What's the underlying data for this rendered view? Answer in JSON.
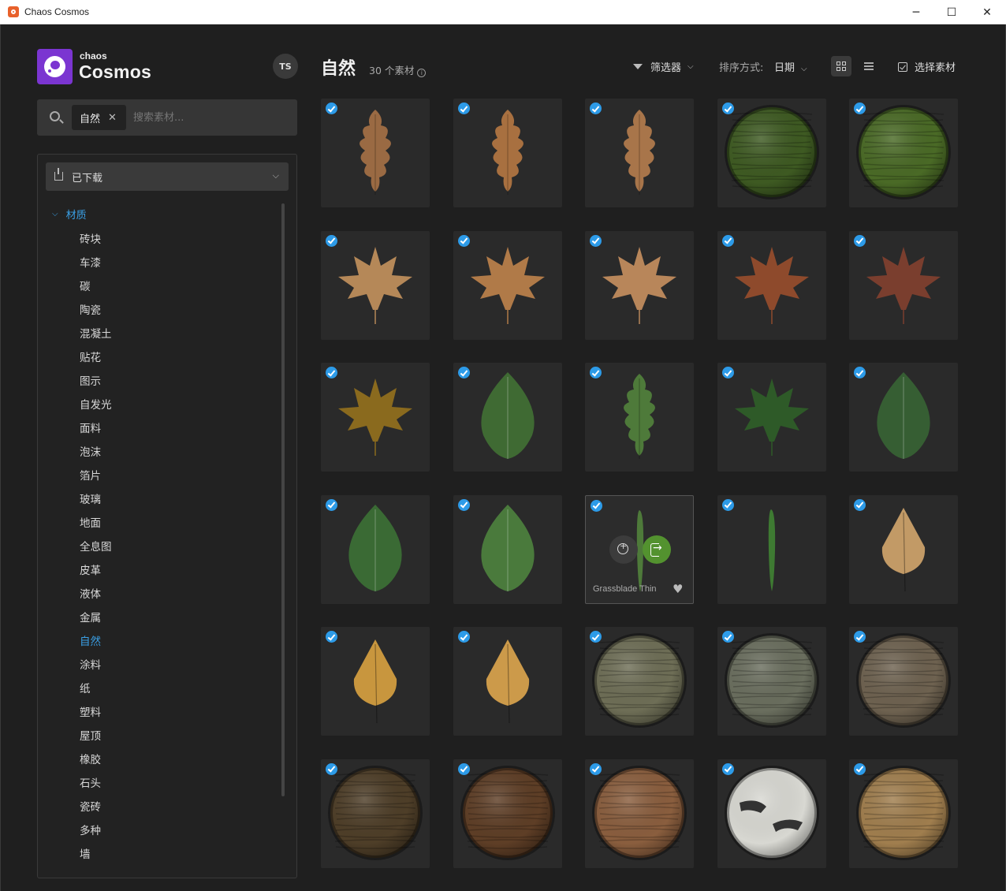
{
  "window": {
    "title": "Chaos Cosmos",
    "min": "─",
    "max": "☐",
    "close": "✕"
  },
  "brand": {
    "small": "chaos",
    "big": "Cosmos"
  },
  "user": {
    "initials": "TS"
  },
  "search": {
    "chip": "自然",
    "chip_remove": "✕",
    "placeholder": "搜索素材..."
  },
  "filter_dropdown": {
    "label": "已下载",
    "chevron": "⌵"
  },
  "tree": {
    "caret": "⌵",
    "heading": "材质"
  },
  "categories": [
    "砖块",
    "车漆",
    "碳",
    "陶瓷",
    "混凝土",
    "贴花",
    "图示",
    "自发光",
    "面料",
    "泡沫",
    "箔片",
    "玻璃",
    "地面",
    "全息图",
    "皮革",
    "液体",
    "金属",
    "自然",
    "涂料",
    "纸",
    "塑料",
    "屋顶",
    "橡胶",
    "石头",
    "瓷砖",
    "多种",
    "墙"
  ],
  "active_category": "自然",
  "header": {
    "title": "自然",
    "count": "30 个素材",
    "info": "i",
    "filter": "筛选器",
    "sort_label": "排序方式:",
    "sort_value": "日期",
    "chevron": "⌵",
    "select": "选择素材"
  },
  "hover_tile": {
    "name": "Grassblade Thin",
    "heart": "♥"
  },
  "assets": [
    {
      "kind": "oak",
      "color": "#9a6a43"
    },
    {
      "kind": "oak",
      "color": "#a87040"
    },
    {
      "kind": "oak",
      "color": "#a8754a"
    },
    {
      "kind": "sphere",
      "color": "#3e5a22"
    },
    {
      "kind": "sphere",
      "color": "#4a6a26"
    },
    {
      "kind": "maple",
      "color": "#b58858"
    },
    {
      "kind": "maple",
      "color": "#b07a48"
    },
    {
      "kind": "maple",
      "color": "#b8865a"
    },
    {
      "kind": "maple",
      "color": "#8e4a2c"
    },
    {
      "kind": "maple",
      "color": "#7a3e2e"
    },
    {
      "kind": "maple",
      "color": "#8a6a1e"
    },
    {
      "kind": "leaf",
      "color": "#3f6a33"
    },
    {
      "kind": "oak",
      "color": "#4e7a3a"
    },
    {
      "kind": "maple",
      "color": "#2e5a28"
    },
    {
      "kind": "leaf",
      "color": "#365e33"
    },
    {
      "kind": "leaf",
      "color": "#3a6a34"
    },
    {
      "kind": "leaf",
      "color": "#4a7a3c"
    },
    {
      "kind": "grass",
      "color": "#4e7a3a"
    },
    {
      "kind": "grass",
      "color": "#3e7a32"
    },
    {
      "kind": "birch",
      "color": "#c29a66"
    },
    {
      "kind": "birch",
      "color": "#c8963e"
    },
    {
      "kind": "birch",
      "color": "#cc9a4a"
    },
    {
      "kind": "sphere",
      "color": "#6e6e56"
    },
    {
      "kind": "sphere",
      "color": "#6a6e5e"
    },
    {
      "kind": "sphere",
      "color": "#6e6250"
    },
    {
      "kind": "sphere",
      "color": "#4e3e28"
    },
    {
      "kind": "sphere",
      "color": "#5e3e26"
    },
    {
      "kind": "sphere",
      "color": "#8a5e3e"
    },
    {
      "kind": "birchbark",
      "color": "#d8d8d2"
    },
    {
      "kind": "sphere",
      "color": "#a07e4e"
    }
  ]
}
